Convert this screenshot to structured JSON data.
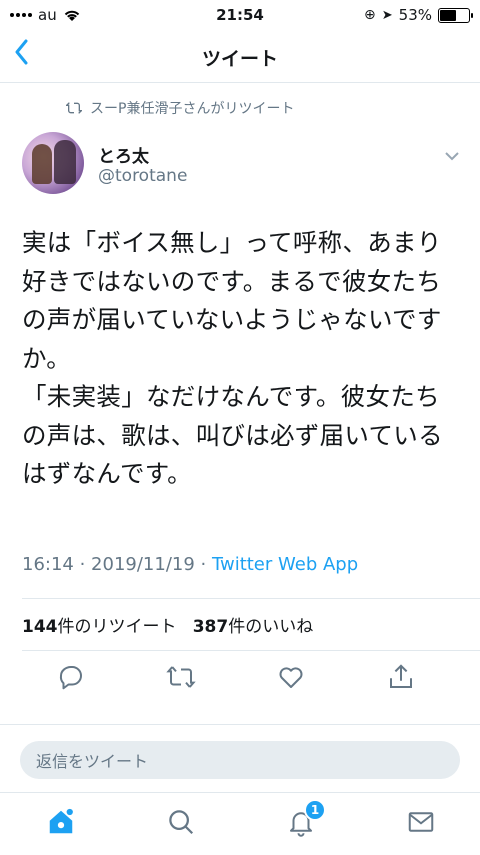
{
  "status_bar": {
    "carrier": "au",
    "time": "21:54",
    "battery": "53%",
    "battery_level": 0.53
  },
  "nav": {
    "title": "ツイート"
  },
  "tweet": {
    "retweeted_by": "スーP兼任滑子さんがリツイート",
    "author_name": "とろ太",
    "author_handle": "@torotane",
    "text": "実は「ボイス無し」って呼称、あまり好きではないのです。まるで彼女たちの声が届いていないようじゃないですか。\n「未実装」なだけなんです。彼女たちの声は、歌は、叫びは必ず届いているはずなんです。",
    "timestamp": "16:14 · 2019/11/19 · ",
    "source": "Twitter Web App",
    "retweet_count": "144",
    "retweet_label": "件のリツイート",
    "like_count": "387",
    "like_label": "件のいいね"
  },
  "reply": {
    "placeholder": "返信をツイート"
  },
  "tabs": {
    "notifications_badge": "1"
  },
  "colors": {
    "accent": "#1da1f2",
    "secondary_text": "#657786",
    "divider": "#e1e8ed"
  }
}
